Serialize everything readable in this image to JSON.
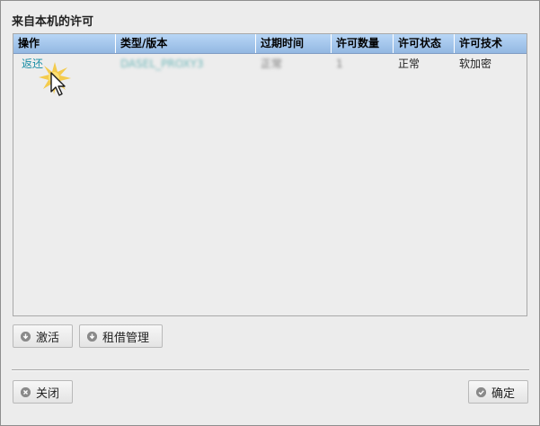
{
  "title": "来自本机的许可",
  "table": {
    "columns": [
      "操作",
      "类型/版本",
      "过期时间",
      "许可数量",
      "许可状态",
      "许可技术"
    ],
    "rows": [
      {
        "action": "返还",
        "type_version": "DASEL_PROXY3",
        "expiry": "正常",
        "count": "1",
        "status": "正常",
        "technology": "软加密"
      }
    ]
  },
  "buttons": {
    "activate": "激活",
    "lease_manage": "租借管理",
    "close": "关闭",
    "ok": "确定"
  },
  "icons": {
    "activate": "download-icon",
    "lease_manage": "download-icon",
    "close": "close-icon",
    "ok": "check-icon"
  }
}
